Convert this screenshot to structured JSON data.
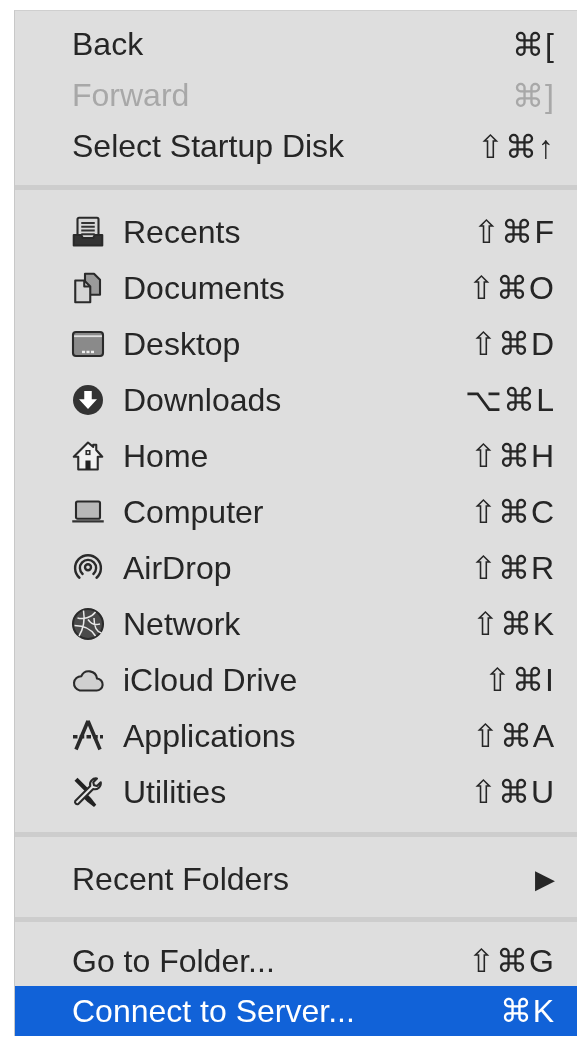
{
  "menu": {
    "sections": [
      {
        "items": [
          {
            "kind": "command",
            "label": "Back",
            "shortcut": "⌘[",
            "disabled": false,
            "selected": false
          },
          {
            "kind": "command",
            "label": "Forward",
            "shortcut": "⌘]",
            "disabled": true,
            "selected": false
          },
          {
            "kind": "command",
            "label": "Select Startup Disk",
            "shortcut": "⇧⌘↑",
            "disabled": false,
            "selected": false
          }
        ]
      },
      {
        "items": [
          {
            "kind": "place",
            "label": "Recents",
            "shortcut": "⇧⌘F",
            "disabled": false,
            "selected": false
          },
          {
            "kind": "place",
            "label": "Documents",
            "shortcut": "⇧⌘O",
            "disabled": false,
            "selected": false
          },
          {
            "kind": "place",
            "label": "Desktop",
            "shortcut": "⇧⌘D",
            "disabled": false,
            "selected": false
          },
          {
            "kind": "place",
            "label": "Downloads",
            "shortcut": "⌥⌘L",
            "disabled": false,
            "selected": false
          },
          {
            "kind": "place",
            "label": "Home",
            "shortcut": "⇧⌘H",
            "disabled": false,
            "selected": false
          },
          {
            "kind": "place",
            "label": "Computer",
            "shortcut": "⇧⌘C",
            "disabled": false,
            "selected": false
          },
          {
            "kind": "place",
            "label": "AirDrop",
            "shortcut": "⇧⌘R",
            "disabled": false,
            "selected": false
          },
          {
            "kind": "place",
            "label": "Network",
            "shortcut": "⇧⌘K",
            "disabled": false,
            "selected": false
          },
          {
            "kind": "place",
            "label": "iCloud Drive",
            "shortcut": "⇧⌘I",
            "disabled": false,
            "selected": false
          },
          {
            "kind": "place",
            "label": "Applications",
            "shortcut": "⇧⌘A",
            "disabled": false,
            "selected": false
          },
          {
            "kind": "place",
            "label": "Utilities",
            "shortcut": "⇧⌘U",
            "disabled": false,
            "selected": false
          }
        ]
      },
      {
        "items": [
          {
            "kind": "submenu",
            "label": "Recent Folders",
            "arrow": "▶",
            "disabled": false,
            "selected": false
          }
        ]
      },
      {
        "items": [
          {
            "kind": "command",
            "label": "Go to Folder...",
            "shortcut": "⇧⌘G",
            "disabled": false,
            "selected": false
          },
          {
            "kind": "command",
            "label": "Connect to Server...",
            "shortcut": "⌘K",
            "disabled": false,
            "selected": true
          }
        ]
      }
    ]
  }
}
